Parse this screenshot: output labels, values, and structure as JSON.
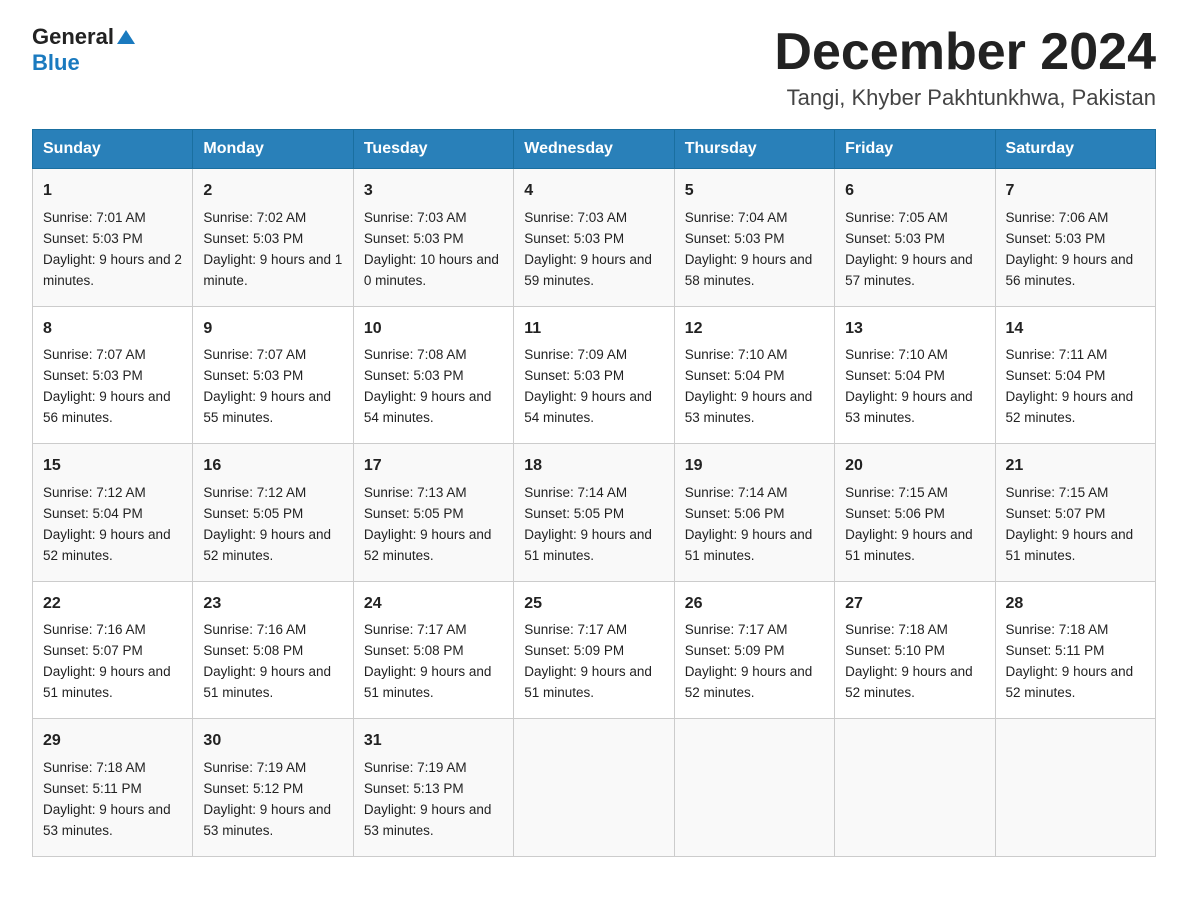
{
  "header": {
    "logo_general": "General",
    "logo_blue": "Blue",
    "month_title": "December 2024",
    "location": "Tangi, Khyber Pakhtunkhwa, Pakistan"
  },
  "days_of_week": [
    "Sunday",
    "Monday",
    "Tuesday",
    "Wednesday",
    "Thursday",
    "Friday",
    "Saturday"
  ],
  "weeks": [
    [
      {
        "day": "1",
        "sunrise": "7:01 AM",
        "sunset": "5:03 PM",
        "daylight": "9 hours and 2 minutes."
      },
      {
        "day": "2",
        "sunrise": "7:02 AM",
        "sunset": "5:03 PM",
        "daylight": "9 hours and 1 minute."
      },
      {
        "day": "3",
        "sunrise": "7:03 AM",
        "sunset": "5:03 PM",
        "daylight": "10 hours and 0 minutes."
      },
      {
        "day": "4",
        "sunrise": "7:03 AM",
        "sunset": "5:03 PM",
        "daylight": "9 hours and 59 minutes."
      },
      {
        "day": "5",
        "sunrise": "7:04 AM",
        "sunset": "5:03 PM",
        "daylight": "9 hours and 58 minutes."
      },
      {
        "day": "6",
        "sunrise": "7:05 AM",
        "sunset": "5:03 PM",
        "daylight": "9 hours and 57 minutes."
      },
      {
        "day": "7",
        "sunrise": "7:06 AM",
        "sunset": "5:03 PM",
        "daylight": "9 hours and 56 minutes."
      }
    ],
    [
      {
        "day": "8",
        "sunrise": "7:07 AM",
        "sunset": "5:03 PM",
        "daylight": "9 hours and 56 minutes."
      },
      {
        "day": "9",
        "sunrise": "7:07 AM",
        "sunset": "5:03 PM",
        "daylight": "9 hours and 55 minutes."
      },
      {
        "day": "10",
        "sunrise": "7:08 AM",
        "sunset": "5:03 PM",
        "daylight": "9 hours and 54 minutes."
      },
      {
        "day": "11",
        "sunrise": "7:09 AM",
        "sunset": "5:03 PM",
        "daylight": "9 hours and 54 minutes."
      },
      {
        "day": "12",
        "sunrise": "7:10 AM",
        "sunset": "5:04 PM",
        "daylight": "9 hours and 53 minutes."
      },
      {
        "day": "13",
        "sunrise": "7:10 AM",
        "sunset": "5:04 PM",
        "daylight": "9 hours and 53 minutes."
      },
      {
        "day": "14",
        "sunrise": "7:11 AM",
        "sunset": "5:04 PM",
        "daylight": "9 hours and 52 minutes."
      }
    ],
    [
      {
        "day": "15",
        "sunrise": "7:12 AM",
        "sunset": "5:04 PM",
        "daylight": "9 hours and 52 minutes."
      },
      {
        "day": "16",
        "sunrise": "7:12 AM",
        "sunset": "5:05 PM",
        "daylight": "9 hours and 52 minutes."
      },
      {
        "day": "17",
        "sunrise": "7:13 AM",
        "sunset": "5:05 PM",
        "daylight": "9 hours and 52 minutes."
      },
      {
        "day": "18",
        "sunrise": "7:14 AM",
        "sunset": "5:05 PM",
        "daylight": "9 hours and 51 minutes."
      },
      {
        "day": "19",
        "sunrise": "7:14 AM",
        "sunset": "5:06 PM",
        "daylight": "9 hours and 51 minutes."
      },
      {
        "day": "20",
        "sunrise": "7:15 AM",
        "sunset": "5:06 PM",
        "daylight": "9 hours and 51 minutes."
      },
      {
        "day": "21",
        "sunrise": "7:15 AM",
        "sunset": "5:07 PM",
        "daylight": "9 hours and 51 minutes."
      }
    ],
    [
      {
        "day": "22",
        "sunrise": "7:16 AM",
        "sunset": "5:07 PM",
        "daylight": "9 hours and 51 minutes."
      },
      {
        "day": "23",
        "sunrise": "7:16 AM",
        "sunset": "5:08 PM",
        "daylight": "9 hours and 51 minutes."
      },
      {
        "day": "24",
        "sunrise": "7:17 AM",
        "sunset": "5:08 PM",
        "daylight": "9 hours and 51 minutes."
      },
      {
        "day": "25",
        "sunrise": "7:17 AM",
        "sunset": "5:09 PM",
        "daylight": "9 hours and 51 minutes."
      },
      {
        "day": "26",
        "sunrise": "7:17 AM",
        "sunset": "5:09 PM",
        "daylight": "9 hours and 52 minutes."
      },
      {
        "day": "27",
        "sunrise": "7:18 AM",
        "sunset": "5:10 PM",
        "daylight": "9 hours and 52 minutes."
      },
      {
        "day": "28",
        "sunrise": "7:18 AM",
        "sunset": "5:11 PM",
        "daylight": "9 hours and 52 minutes."
      }
    ],
    [
      {
        "day": "29",
        "sunrise": "7:18 AM",
        "sunset": "5:11 PM",
        "daylight": "9 hours and 53 minutes."
      },
      {
        "day": "30",
        "sunrise": "7:19 AM",
        "sunset": "5:12 PM",
        "daylight": "9 hours and 53 minutes."
      },
      {
        "day": "31",
        "sunrise": "7:19 AM",
        "sunset": "5:13 PM",
        "daylight": "9 hours and 53 minutes."
      },
      {
        "day": "",
        "sunrise": "",
        "sunset": "",
        "daylight": ""
      },
      {
        "day": "",
        "sunrise": "",
        "sunset": "",
        "daylight": ""
      },
      {
        "day": "",
        "sunrise": "",
        "sunset": "",
        "daylight": ""
      },
      {
        "day": "",
        "sunrise": "",
        "sunset": "",
        "daylight": ""
      }
    ]
  ],
  "daylight_label": "Daylight:",
  "sunrise_label": "Sunrise:",
  "sunset_label": "Sunset:"
}
